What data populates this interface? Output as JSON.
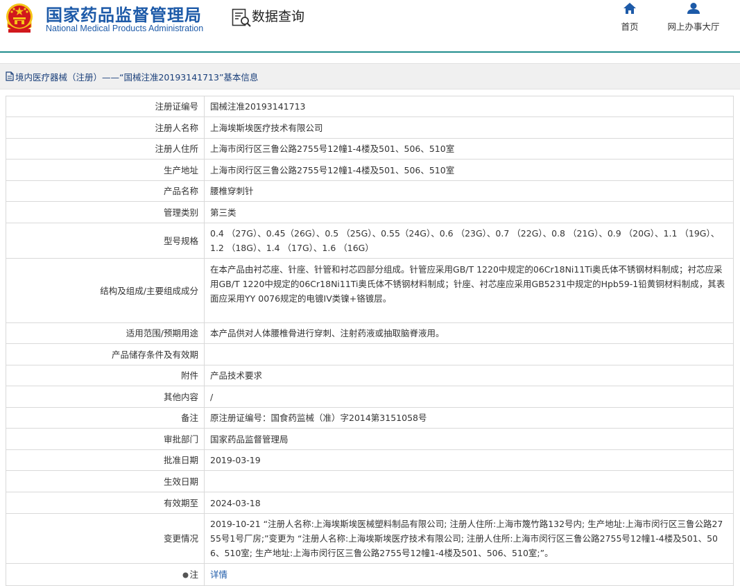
{
  "header": {
    "site_title_cn": "国家药品监督管理局",
    "site_title_en": "National Medical Products Administration",
    "section_title": "数据查询",
    "nav": [
      {
        "label": "首页",
        "icon": "home-icon"
      },
      {
        "label": "网上办事大厅",
        "icon": "user-icon"
      }
    ]
  },
  "colors": {
    "brand_blue": "#1d5aa8",
    "header_rule": "#1f8d8d",
    "emblem_red": "#d1181d",
    "emblem_gold": "#f5c518"
  },
  "breadcrumb": "境内医疗器械（注册）——“国械注准20193141713”基本信息",
  "rows": [
    {
      "label": "注册证编号",
      "value": "国械注准20193141713"
    },
    {
      "label": "注册人名称",
      "value": "上海埃斯埃医疗技术有限公司"
    },
    {
      "label": "注册人住所",
      "value": "上海市闵行区三鲁公路2755号12幢1-4楼及501、506、510室"
    },
    {
      "label": "生产地址",
      "value": "上海市闵行区三鲁公路2755号12幢1-4楼及501、506、510室"
    },
    {
      "label": "产品名称",
      "value": "腰椎穿刺针"
    },
    {
      "label": "管理类别",
      "value": "第三类"
    },
    {
      "label": "型号规格",
      "value": "0.4 （27G）、0.45（26G）、0.5 （25G）、0.55（24G）、0.6 （23G）、0.7 （22G）、0.8 （21G）、0.9 （20G）、1.1 （19G）、1.2 （18G）、1.4 （17G）、1.6 （16G）"
    },
    {
      "label": "结构及组成/主要组成成分",
      "value": "在本产品由衬芯座、针座、针管和衬芯四部分组成。针管应采用GB/T 1220中规定的06Cr18Ni11Ti奥氏体不锈钢材料制成；衬芯应采用GB/T 1220中规定的06Cr18Ni11Ti奥氏体不锈钢材料制成；针座、衬芯座应采用GB5231中规定的Hpb59-1铅黄铜材料制成，其表面应采用YY 0076规定的电镀IV类镍+铬镀层。"
    },
    {
      "label": "适用范围/预期用途",
      "value": "本产品供对人体腰椎骨进行穿刺、注射药液或抽取脑脊液用。"
    },
    {
      "label": "产品储存条件及有效期",
      "value": ""
    },
    {
      "label": "附件",
      "value": "产品技术要求"
    },
    {
      "label": "其他内容",
      "value": "/"
    },
    {
      "label": "备注",
      "value": "原注册证编号：国食药监械（准）字2014第3151058号"
    },
    {
      "label": "审批部门",
      "value": "国家药品监督管理局"
    },
    {
      "label": "批准日期",
      "value": "2019-03-19"
    },
    {
      "label": "生效日期",
      "value": ""
    },
    {
      "label": "有效期至",
      "value": "2024-03-18"
    },
    {
      "label": "变更情况",
      "value": "2019-10-21 “注册人名称:上海埃斯埃医械塑料制品有限公司; 注册人住所:上海市篾竹路132号内; 生产地址:上海市闵行区三鲁公路2755号1号厂房;”变更为 “注册人名称:上海埃斯埃医疗技术有限公司; 注册人住所:上海市闵行区三鲁公路2755号12幢1-4楼及501、506、510室; 生产地址:上海市闵行区三鲁公路2755号12幢1-4楼及501、506、510室;”。"
    }
  ],
  "note": {
    "label": "注",
    "link": "详情"
  }
}
